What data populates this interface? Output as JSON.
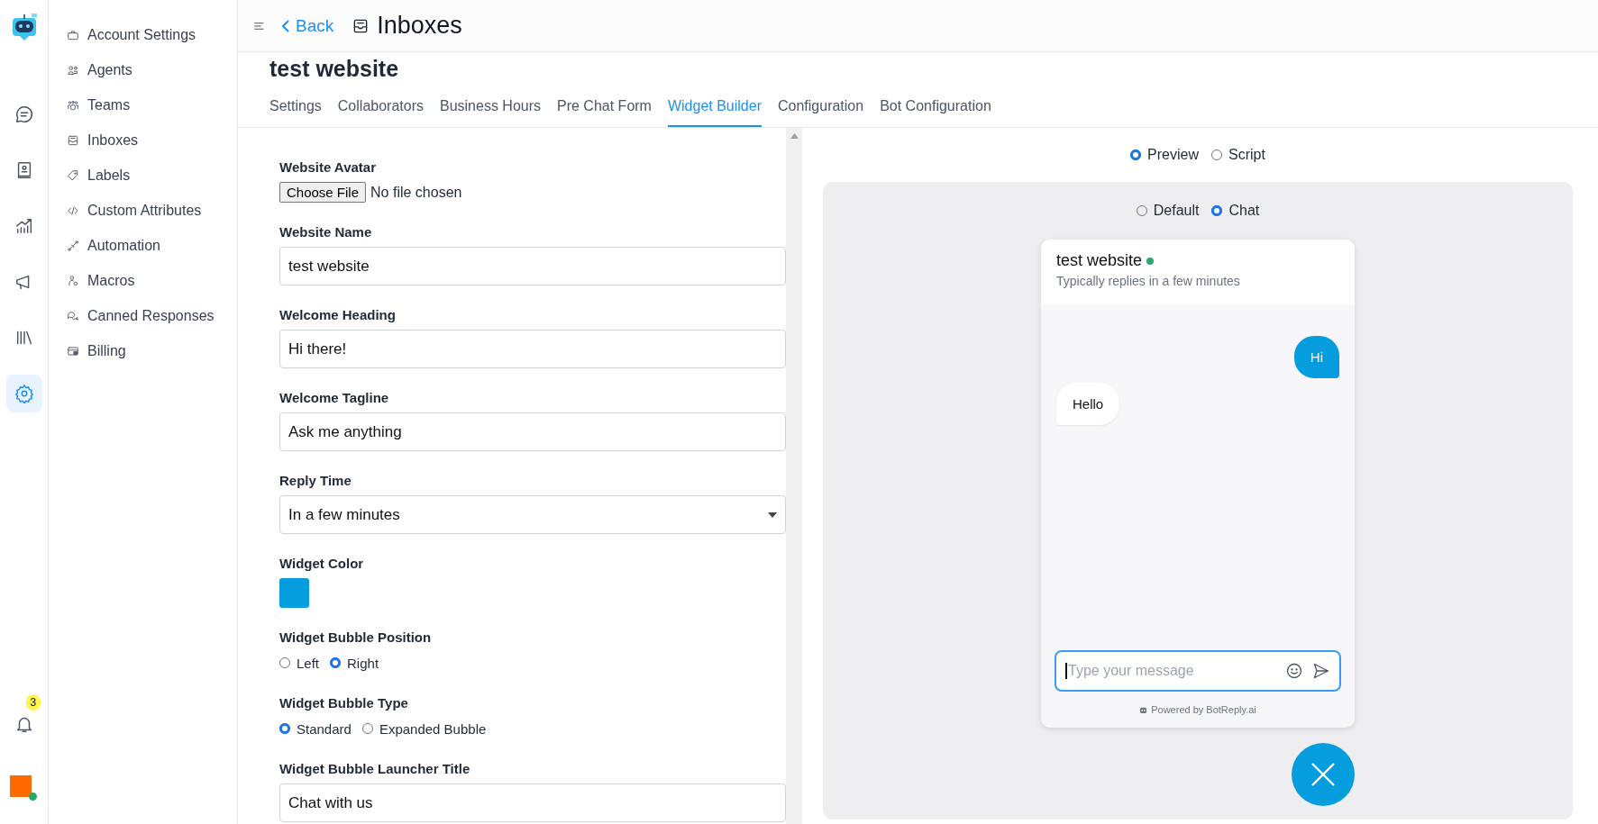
{
  "rail": {
    "items": [
      {
        "kind": "chat",
        "selected": false
      },
      {
        "kind": "contacts",
        "selected": false
      },
      {
        "kind": "reports",
        "selected": false
      },
      {
        "kind": "campaigns",
        "selected": false
      },
      {
        "kind": "library",
        "selected": false
      },
      {
        "kind": "settings",
        "selected": true
      }
    ],
    "notifications": {
      "count": "3"
    },
    "account": {
      "online": true
    }
  },
  "sidebar": {
    "items": [
      {
        "kind": "briefcase",
        "label": "Account Settings",
        "selected": false
      },
      {
        "kind": "agents",
        "label": "Agents",
        "selected": false
      },
      {
        "kind": "teams",
        "label": "Teams",
        "selected": false
      },
      {
        "kind": "inbox",
        "label": "Inboxes",
        "selected": false
      },
      {
        "kind": "tag",
        "label": "Labels",
        "selected": false
      },
      {
        "kind": "code",
        "label": "Custom Attributes",
        "selected": false
      },
      {
        "kind": "automation",
        "label": "Automation",
        "selected": false
      },
      {
        "kind": "macro",
        "label": "Macros",
        "selected": false
      },
      {
        "kind": "canned",
        "label": "Canned Responses",
        "selected": false
      },
      {
        "kind": "billing",
        "label": "Billing",
        "selected": false
      }
    ]
  },
  "header": {
    "back": "Back",
    "title": "Inboxes"
  },
  "page_title": "test website",
  "tabs": [
    {
      "label": "Settings",
      "selected": false
    },
    {
      "label": "Collaborators",
      "selected": false
    },
    {
      "label": "Business Hours",
      "selected": false
    },
    {
      "label": "Pre Chat Form",
      "selected": false
    },
    {
      "label": "Widget Builder",
      "selected": true
    },
    {
      "label": "Configuration",
      "selected": false
    },
    {
      "label": "Bot Configuration",
      "selected": false
    }
  ],
  "form": {
    "fields": [
      {
        "kind": "file",
        "label": "Website Avatar",
        "button": "Choose File",
        "value": "No file chosen"
      },
      {
        "kind": "text",
        "label": "Website Name",
        "value": "test website"
      },
      {
        "kind": "text",
        "label": "Welcome Heading",
        "value": "Hi there!"
      },
      {
        "kind": "text",
        "label": "Welcome Tagline",
        "value": "Ask me anything"
      },
      {
        "kind": "select",
        "label": "Reply Time",
        "value": "In a few minutes"
      },
      {
        "kind": "color",
        "label": "Widget Color",
        "color": "#069ddf"
      },
      {
        "kind": "radio",
        "label": "Widget Bubble Position",
        "options": [
          {
            "label": "Left",
            "selected": false
          },
          {
            "label": "Right",
            "selected": true
          }
        ]
      },
      {
        "kind": "radio",
        "label": "Widget Bubble Type",
        "options": [
          {
            "label": "Standard",
            "selected": true
          },
          {
            "label": "Expanded Bubble",
            "selected": false
          }
        ]
      },
      {
        "kind": "text",
        "label": "Widget Bubble Launcher Title",
        "value": "Chat with us"
      }
    ]
  },
  "preview": {
    "modes": [
      {
        "label": "Preview",
        "selected": true
      },
      {
        "label": "Script",
        "selected": false
      }
    ],
    "styles": [
      {
        "label": "Default",
        "selected": false
      },
      {
        "label": "Chat",
        "selected": true
      }
    ],
    "widget": {
      "name": "test website",
      "online": true,
      "subtitle": "Typically replies in a few minutes",
      "messages": [
        {
          "kind": "user",
          "text": "Hi"
        },
        {
          "kind": "bot",
          "text": "Hello"
        }
      ],
      "placeholder": "Type your message",
      "powered_by": "Powered by BotReply.ai"
    }
  }
}
